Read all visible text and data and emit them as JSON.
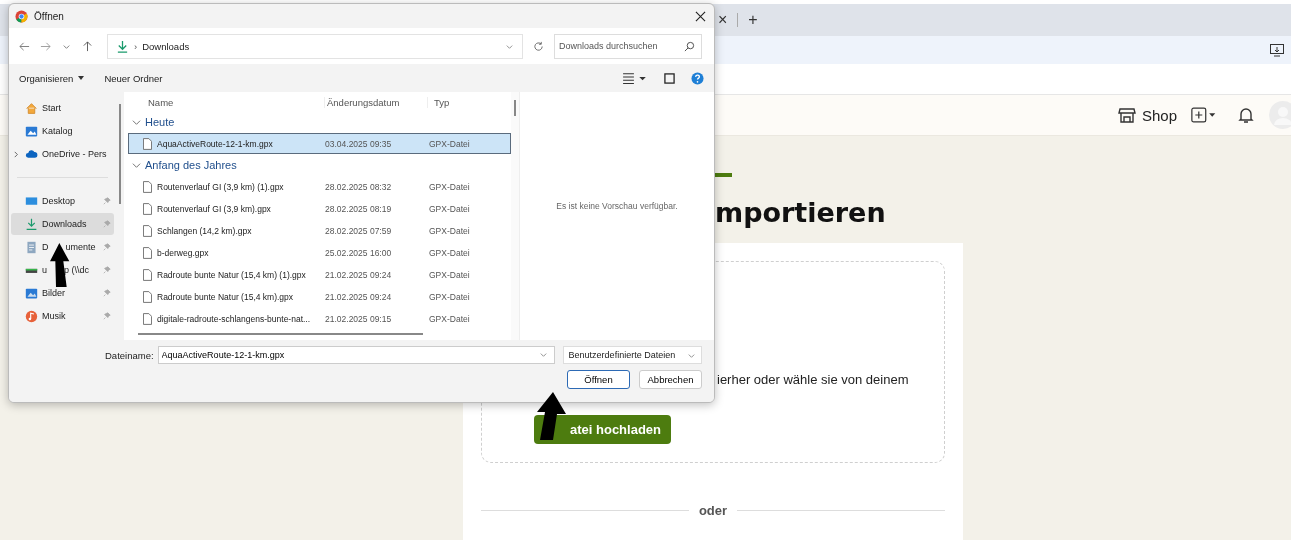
{
  "browser": {
    "tab_close": "×",
    "new_tab": "+"
  },
  "page_header": {
    "shop": "Shop"
  },
  "page": {
    "heading": "mportieren",
    "drop_text": "ierher oder wähle sie von deinem",
    "upload_button": "atei hochladen",
    "divider_text": "oder"
  },
  "dialog": {
    "title": "Öffnen",
    "path_separator": "›",
    "path": "Downloads",
    "search": {
      "placeholder": "Downloads durchsuchen"
    },
    "toolbar": [
      {
        "label": "Organisieren",
        "dropdown": true
      },
      {
        "label": "Neuer Ordner",
        "dropdown": false
      }
    ],
    "sidebar": [
      {
        "kind": "home",
        "label_parts": [
          "Start"
        ],
        "pinned": false,
        "selected": false,
        "expandable": false
      },
      {
        "kind": "gallery",
        "label_parts": [
          "Katalog"
        ],
        "pinned": false,
        "selected": false,
        "expandable": false
      },
      {
        "kind": "cloud",
        "label_parts": [
          "OneDrive - Pers"
        ],
        "pinned": false,
        "selected": false,
        "expandable": true
      },
      {
        "kind": "separator"
      },
      {
        "kind": "desktop",
        "label_parts": [
          "Desktop"
        ],
        "pinned": true,
        "selected": false,
        "expandable": false
      },
      {
        "kind": "download",
        "label_parts": [
          "Downloads"
        ],
        "pinned": true,
        "selected": true,
        "expandable": false
      },
      {
        "kind": "document",
        "label_parts": [
          "D",
          "umente"
        ],
        "pinned": true,
        "selected": false,
        "expandable": false
      },
      {
        "kind": "drive",
        "label_parts": [
          "u",
          "p (\\\\dc"
        ],
        "pinned": true,
        "selected": false,
        "expandable": false
      },
      {
        "kind": "pictures",
        "label_parts": [
          "Bilder"
        ],
        "pinned": true,
        "selected": false,
        "expandable": false
      },
      {
        "kind": "music",
        "label_parts": [
          "Musik"
        ],
        "pinned": true,
        "selected": false,
        "expandable": false
      }
    ],
    "columns": [
      "Name",
      "Änderungsdatum",
      "Typ"
    ],
    "groups": [
      {
        "label": "Heute",
        "expanded": true,
        "files": [
          {
            "name": "AquaActiveRoute-12-1-km.gpx",
            "date": "03.04.2025 09:35",
            "type": "GPX-Datei",
            "selected": true
          }
        ]
      },
      {
        "label": "Anfang des Jahres",
        "expanded": true,
        "files": [
          {
            "name": "Routenverlauf GI (3,9 km) (1).gpx",
            "date": "28.02.2025 08:32",
            "type": "GPX-Datei",
            "selected": false
          },
          {
            "name": "Routenverlauf GI (3,9 km).gpx",
            "date": "28.02.2025 08:19",
            "type": "GPX-Datei",
            "selected": false
          },
          {
            "name": "Schlangen (14,2 km).gpx",
            "date": "28.02.2025 07:59",
            "type": "GPX-Datei",
            "selected": false
          },
          {
            "name": "b-derweg.gpx",
            "date": "25.02.2025 16:00",
            "type": "GPX-Datei",
            "selected": false
          },
          {
            "name": "Radroute bunte Natur (15,4 km) (1).gpx",
            "date": "21.02.2025 09:24",
            "type": "GPX-Datei",
            "selected": false
          },
          {
            "name": "Radroute bunte Natur (15,4 km).gpx",
            "date": "21.02.2025 09:24",
            "type": "GPX-Datei",
            "selected": false
          },
          {
            "name": "digitale-radroute-schlangens-bunte-nat...",
            "date": "21.02.2025 09:15",
            "type": "GPX-Datei",
            "selected": false
          }
        ]
      }
    ],
    "preview": "Es ist keine Vorschau verfügbar.",
    "filename": {
      "label": "Dateiname:",
      "value": "AquaActiveRoute-12-1-km.gpx"
    },
    "filter": "Benutzerdefinierte Dateien",
    "buttons": [
      {
        "label": "Öffnen",
        "default": true
      },
      {
        "label": "Abbrechen",
        "default": false
      }
    ]
  }
}
